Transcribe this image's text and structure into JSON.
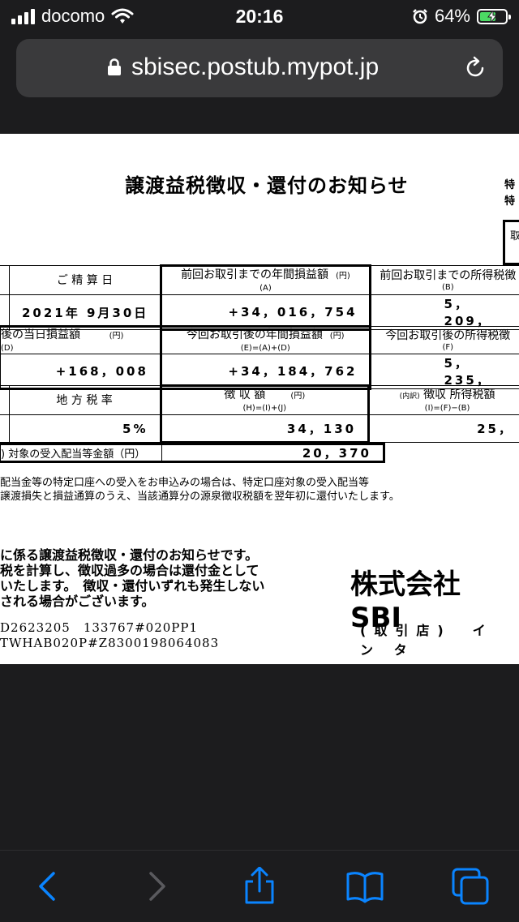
{
  "status_bar": {
    "carrier": "docomo",
    "time": "20:16",
    "battery_percent": "64%",
    "battery_level": 0.64,
    "signal_bars": 4,
    "icons": [
      "signal-icon",
      "wifi-icon",
      "alarm-icon",
      "battery-charging-icon"
    ]
  },
  "address_bar": {
    "url": "sbisec.postub.mypot.jp",
    "icons": [
      "lock-icon",
      "reload-icon"
    ]
  },
  "document": {
    "title": "譲渡益税徴収・還付のお知らせ",
    "right_clips": [
      "特",
      "特",
      "取"
    ],
    "row1": {
      "date_header": "ご 精 算 日",
      "date_value": "2021年 9月30日",
      "prev_annual_header": "前回お取引までの年間損益額",
      "prev_annual_yen": "(円)",
      "prev_annual_sub": "(A)",
      "prev_annual_value": "+34，016，754",
      "prev_tax_header": "前回お取引までの所得税徴",
      "prev_tax_sub": "(B)",
      "prev_tax_value": "5，209，"
    },
    "row2": {
      "day_header": "後の当日損益額",
      "day_yen": "(円)",
      "day_sub": "(D)",
      "day_value": "+168，008",
      "curr_annual_header": "今回お取引後の年間損益額",
      "curr_annual_yen": "(円)",
      "curr_annual_sub": "(E)=(A)+(D)",
      "curr_annual_value": "+34，184，762",
      "curr_tax_header": "今回お取引後の所得税徴",
      "curr_tax_sub": "(F)",
      "curr_tax_value": "5，235，"
    },
    "row3": {
      "local_header": "地 方 税 率",
      "local_value": "5%",
      "collected_header": "徴 収 額",
      "collected_yen": "(円)",
      "collected_sub": "(H)=(I)+(J)",
      "collected_value": "34，130",
      "breakdown_prefix": "(内訳)",
      "breakdown_header": "徴収 所得税額",
      "breakdown_sub": "(I)=(F)−(B)",
      "breakdown_value": "25，"
    },
    "row4": {
      "label": ") 対象の受入配当等金額（円）",
      "value": "20，370"
    },
    "notes": [
      "配当金等の特定口座への受入をお申込みの場合は、特定口座対象の受入配当等",
      "譲渡損失と損益通算のうえ、当該通算分の源泉徴収税額を翌年初に還付いたします。"
    ],
    "notice": [
      "に係る譲渡益税徴収・還付のお知らせです。",
      "税を計算し、徴収過多の場合は還付金として",
      "いたします。　徴収・還付いずれも発生しない",
      "される場合がございます。"
    ],
    "company": "株式会社 SBI",
    "branch": "(取引店)　イ ン タ",
    "codes": [
      "D2623205　133767#020PP1",
      "TWHAB020P#Z8300198064083"
    ]
  },
  "toolbar": {
    "icons": [
      "back-icon",
      "forward-icon",
      "share-icon",
      "bookmarks-icon",
      "tabs-icon"
    ]
  },
  "colors": {
    "chrome_bg": "#1c1c1e",
    "urlbar_bg": "#3a3a3c",
    "accent_blue": "#0a84ff",
    "disabled_gray": "#5a5a5e",
    "battery_green": "#4cd964"
  }
}
